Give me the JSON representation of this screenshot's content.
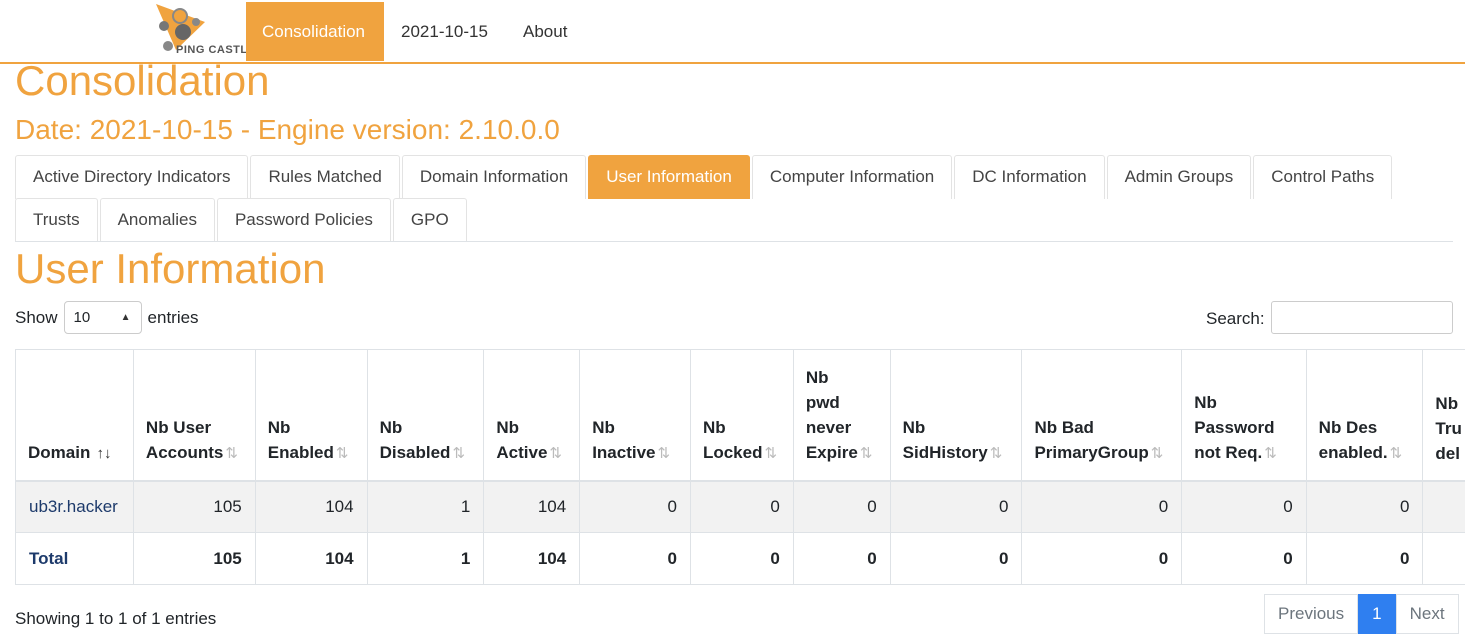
{
  "navbar": {
    "logo_text": "PING CASTLE",
    "items": [
      "Consolidation",
      "2021-10-15",
      "About"
    ]
  },
  "page": {
    "title": "Consolidation",
    "subtitle": "Date: 2021-10-15 - Engine version: 2.10.0.0"
  },
  "tabs": {
    "row1": [
      "Active Directory Indicators",
      "Rules Matched",
      "Domain Information",
      "User Information",
      "Computer Information",
      "DC Information",
      "Admin Groups",
      "Control Paths"
    ],
    "row2": [
      "Trusts",
      "Anomalies",
      "Password Policies",
      "GPO"
    ],
    "active": "User Information"
  },
  "section": {
    "title": "User Information",
    "show_label": "Show",
    "entries_value": "10",
    "entries_label": "entries",
    "search_label": "Search:",
    "search_value": ""
  },
  "table": {
    "columns": [
      [
        "Domain"
      ],
      [
        "Nb User",
        "Accounts"
      ],
      [
        "Nb",
        "Enabled"
      ],
      [
        "Nb",
        "Disabled"
      ],
      [
        "Nb",
        "Active"
      ],
      [
        "Nb",
        "Inactive"
      ],
      [
        "Nb",
        "Locked"
      ],
      [
        "Nb",
        "pwd",
        "never",
        "Expire"
      ],
      [
        "Nb",
        "SidHistory"
      ],
      [
        "Nb Bad",
        "PrimaryGroup"
      ],
      [
        "Nb",
        "Password",
        "not Req."
      ],
      [
        "Nb Des",
        "enabled."
      ],
      [
        "Nb",
        "Tru",
        "del"
      ]
    ],
    "rows": [
      [
        "ub3r.hacker",
        "105",
        "104",
        "1",
        "104",
        "0",
        "0",
        "0",
        "0",
        "0",
        "0",
        "0",
        ""
      ]
    ],
    "total": [
      "Total",
      "105",
      "104",
      "1",
      "104",
      "0",
      "0",
      "0",
      "0",
      "0",
      "0",
      "0",
      ""
    ]
  },
  "footer": {
    "showing": "Showing 1 to 1 of 1 entries",
    "previous": "Previous",
    "page": "1",
    "next": "Next"
  },
  "colors": {
    "accent": "#f0a33f",
    "pager_active": "#2f7ff0",
    "link": "#1d3a6b"
  }
}
